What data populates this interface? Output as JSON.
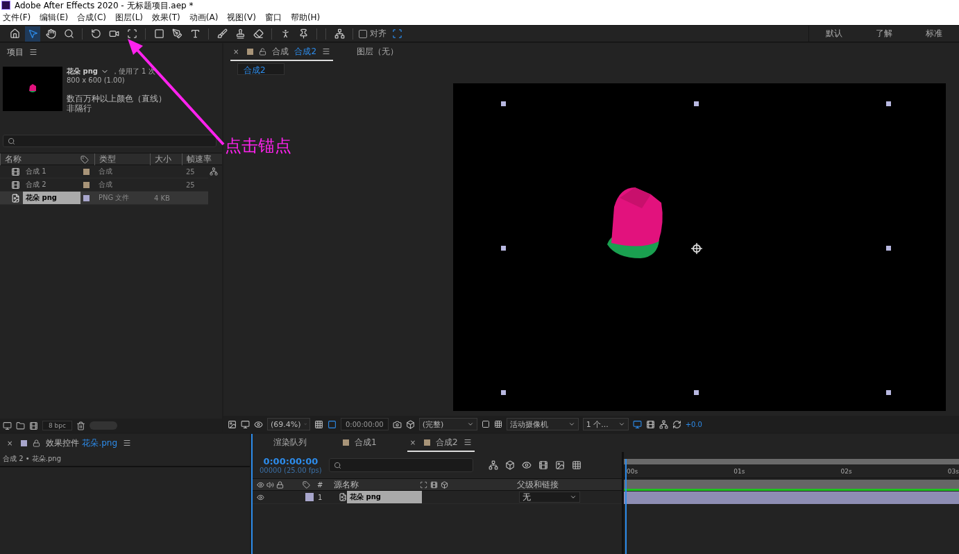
{
  "window": {
    "title": "Adobe After Effects 2020 - 无标题项目.aep *"
  },
  "menu": [
    "文件(F)",
    "编辑(E)",
    "合成(C)",
    "图层(L)",
    "效果(T)",
    "动画(A)",
    "视图(V)",
    "窗口",
    "帮助(H)"
  ],
  "tools": [
    {
      "kind": "home",
      "selected": false
    },
    {
      "kind": "select",
      "selected": true
    },
    {
      "kind": "hand",
      "selected": false
    },
    {
      "kind": "zoom",
      "selected": false
    },
    {
      "kind": "rotate",
      "selected": false
    },
    {
      "kind": "camera",
      "selected": false
    },
    {
      "kind": "anchor",
      "selected": false
    },
    {
      "kind": "rect",
      "selected": false
    },
    {
      "kind": "pen",
      "selected": false
    },
    {
      "kind": "text",
      "selected": false
    },
    {
      "kind": "brush",
      "selected": false
    },
    {
      "kind": "stamp",
      "selected": false
    },
    {
      "kind": "eraser",
      "selected": false
    },
    {
      "kind": "roto",
      "selected": false
    },
    {
      "kind": "pin",
      "selected": false
    }
  ],
  "align": {
    "label": "对齐",
    "checked": false
  },
  "workspaces": [
    {
      "label": "默认"
    },
    {
      "label": "了解"
    },
    {
      "label": "标准"
    }
  ],
  "project": {
    "title": "项目",
    "asset_name": "花朵 png",
    "asset_usage": "，使用了 1 次",
    "asset_size": "800 x 600 (1.00)",
    "asset_color": "数百万种以上颜色（直线）",
    "asset_field": "非隔行",
    "columns": [
      "名称",
      "类型",
      "大小",
      "帧速率"
    ],
    "rows": [
      {
        "kind": "comp",
        "name": "合成 1",
        "color": "#a89478",
        "type": "合成",
        "size": "",
        "fps": "25",
        "selected": false
      },
      {
        "kind": "comp",
        "name": "合成 2",
        "color": "#a89478",
        "type": "合成",
        "size": "",
        "fps": "25",
        "selected": false
      },
      {
        "kind": "file",
        "name": "花朵 png",
        "color": "#a8a6cc",
        "type": "PNG 文件",
        "size": "4 KB",
        "fps": "",
        "selected": true
      }
    ],
    "bpc": "8 bpc"
  },
  "composition": {
    "tabs": [
      {
        "close": "×",
        "label": "合成",
        "target": "合成2",
        "selected": true
      },
      {
        "label": "图层（无）",
        "selected": false
      }
    ],
    "breadcrumb": "合成2",
    "zoom": "(69.4%)",
    "timecode": "0:00:00:00",
    "resolution": "(完整)",
    "camera": "活动摄像机",
    "views": "1 个...",
    "exposure": "+0.0"
  },
  "effects": {
    "close": "×",
    "label": "效果控件",
    "target": "花朵.png",
    "path": "合成 2 • 花朵.png"
  },
  "timeline": {
    "tabs": [
      {
        "label": "渲染队列",
        "swatch": false,
        "selected": false
      },
      {
        "label": "合成1",
        "swatch": true,
        "selected": false
      },
      {
        "close": "×",
        "label": "合成2",
        "swatch": true,
        "selected": true
      }
    ],
    "timecode": "0:00:00:00",
    "frames": "00000 (25.00 fps)",
    "columns": [
      "#",
      "源名称",
      "父级和链接"
    ],
    "layers": [
      {
        "index": "1",
        "name": "花朵 png",
        "parent": "无",
        "visible": true
      }
    ],
    "ticks": [
      "00s",
      "01s",
      "02s",
      "03s"
    ]
  },
  "annotation": {
    "text": "点击锚点"
  }
}
